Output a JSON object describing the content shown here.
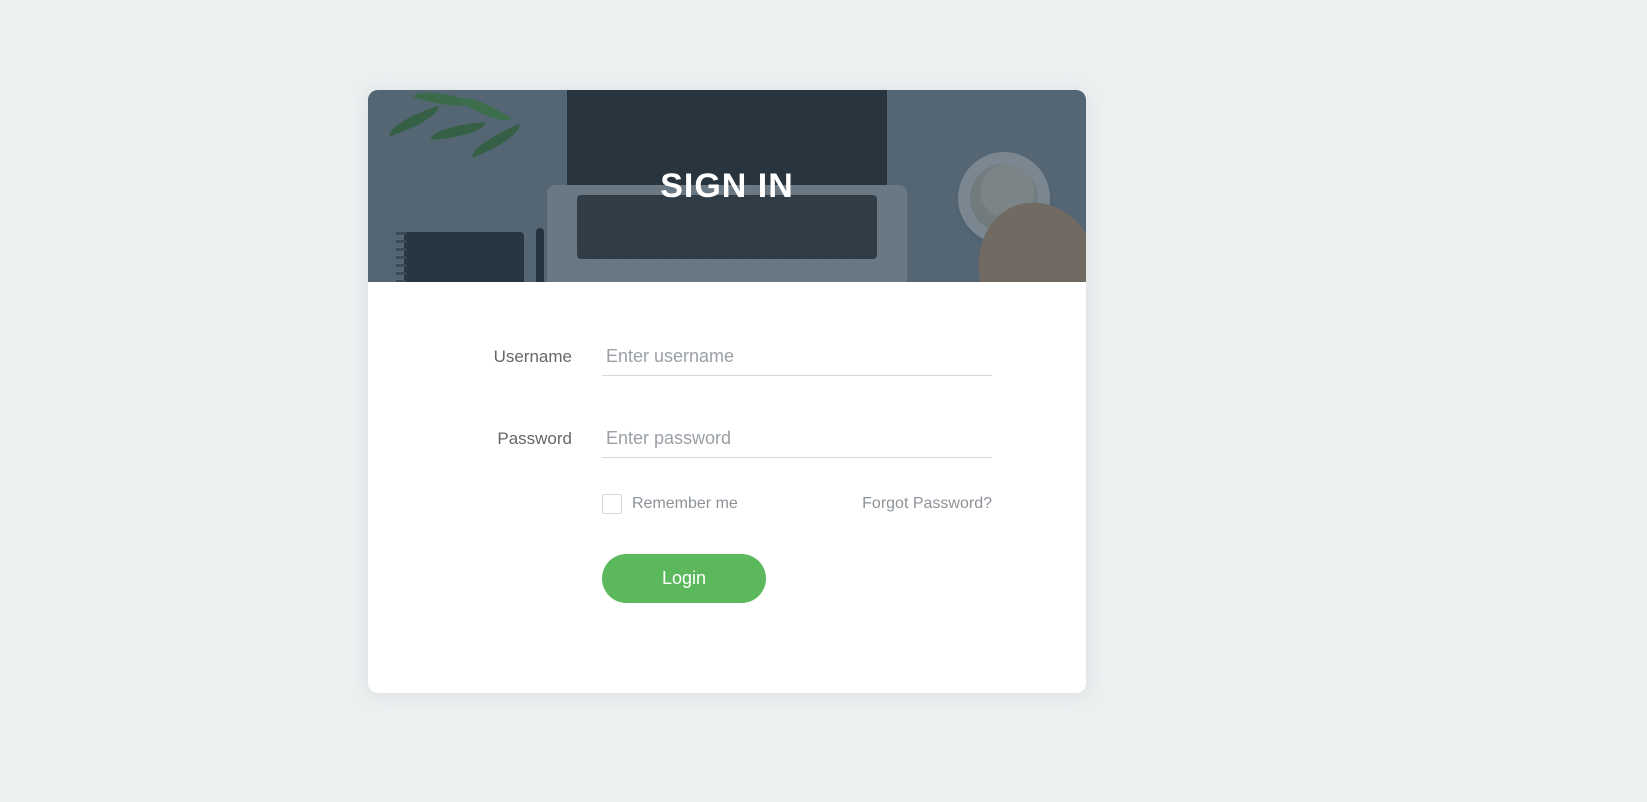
{
  "header": {
    "title": "SIGN IN"
  },
  "form": {
    "username": {
      "label": "Username",
      "placeholder": "Enter username",
      "value": ""
    },
    "password": {
      "label": "Password",
      "placeholder": "Enter password",
      "value": ""
    },
    "remember_label": "Remember me",
    "forgot_label": "Forgot Password?",
    "login_button": "Login"
  },
  "colors": {
    "accent": "#5cb85c",
    "page_bg": "#ecf0f1",
    "overlay": "rgba(51,71,86,0.62)"
  }
}
